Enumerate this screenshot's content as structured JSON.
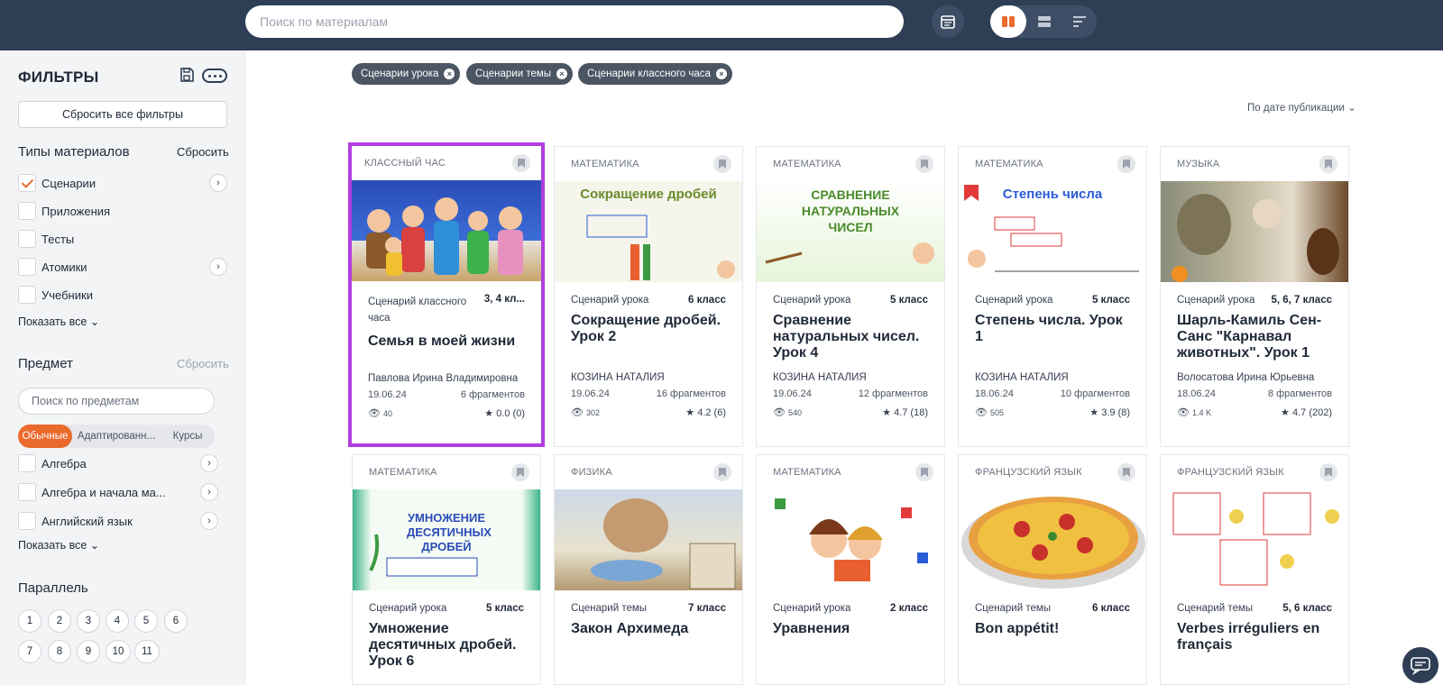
{
  "topbar": {
    "search_placeholder": "Поиск по материалам"
  },
  "sidebar": {
    "title": "ФИЛЬТРЫ",
    "reset_all": "Сбросить все фильтры",
    "types": {
      "title": "Типы материалов",
      "reset": "Сбросить",
      "items": [
        {
          "label": "Сценарии",
          "checked": true
        },
        {
          "label": "Приложения",
          "checked": false
        },
        {
          "label": "Тесты",
          "checked": false
        },
        {
          "label": "Атомики",
          "checked": false
        },
        {
          "label": "Учебники",
          "checked": false
        }
      ],
      "show_all": "Показать все"
    },
    "subject": {
      "title": "Предмет",
      "reset": "Сбросить",
      "search_placeholder": "Поиск по предметам",
      "segments": [
        "Обычные",
        "Адаптированн...",
        "Курсы"
      ],
      "items": [
        {
          "label": "Алгебра"
        },
        {
          "label": "Алгебра и начала ма..."
        },
        {
          "label": "Английский язык"
        }
      ],
      "show_all": "Показать все"
    },
    "parallel": {
      "title": "Параллель",
      "grades": [
        "1",
        "2",
        "3",
        "4",
        "5",
        "6",
        "7",
        "8",
        "9",
        "10",
        "11"
      ]
    }
  },
  "main": {
    "chips": [
      "Сценарии урока",
      "Сценарии темы",
      "Сценарии классного часа"
    ],
    "sort": "По дате публикации",
    "cards": [
      {
        "subject": "Классный час",
        "type": "Сценарий классного часа",
        "grade": "3, 4 кл...",
        "title": "Семья в моей жизни",
        "author": "Павлова Ирина Владимировна",
        "date": "19.06.24",
        "fragments": "6 фрагментов",
        "views": "40",
        "rating": "0.0 (0)",
        "image_caption": ""
      },
      {
        "subject": "Математика",
        "type": "Сценарий урока",
        "grade": "6 класс",
        "title": "Сокращение дробей. Урок 2",
        "author": "КОЗИНА НАТАЛИЯ",
        "date": "19.06.24",
        "fragments": "16 фрагментов",
        "views": "302",
        "rating": "4.2 (6)",
        "image_caption": "Сокращение дробей"
      },
      {
        "subject": "Математика",
        "type": "Сценарий урока",
        "grade": "5 класс",
        "title": "Сравнение натуральных чисел. Урок 4",
        "author": "КОЗИНА НАТАЛИЯ",
        "date": "19.06.24",
        "fragments": "12 фрагментов",
        "views": "540",
        "rating": "4.7 (18)",
        "image_caption": "СРАВНЕНИЕ НАТУРАЛЬНЫХ ЧИСЕЛ"
      },
      {
        "subject": "Математика",
        "type": "Сценарий урока",
        "grade": "5 класс",
        "title": "Степень числа. Урок 1",
        "author": "КОЗИНА НАТАЛИЯ",
        "date": "18.06.24",
        "fragments": "10 фрагментов",
        "views": "505",
        "rating": "3.9 (8)",
        "image_caption": "Степень числа"
      },
      {
        "subject": "Музыка",
        "type": "Сценарий урока",
        "grade": "5, 6, 7 класс",
        "title": "Шарль-Камиль Сен-Санс \"Карнавал животных\". Урок 1",
        "author": "Волосатова Ирина Юрьевна",
        "date": "18.06.24",
        "fragments": "8 фрагментов",
        "views": "1.4 K",
        "rating": "4.7 (202)",
        "image_caption": ""
      },
      {
        "subject": "Математика",
        "type": "Сценарий урока",
        "grade": "5 класс",
        "title": "Умножение десятичных дробей. Урок 6",
        "image_caption": "УМНОЖЕНИЕ ДЕСЯТИЧНЫХ ДРОБЕЙ"
      },
      {
        "subject": "Физика",
        "type": "Сценарий темы",
        "grade": "7 класс",
        "title": "Закон Архимеда",
        "image_caption": ""
      },
      {
        "subject": "Математика",
        "type": "Сценарий урока",
        "grade": "2 класс",
        "title": "Уравнения",
        "image_caption": ""
      },
      {
        "subject": "Французский язык",
        "type": "Сценарий темы",
        "grade": "6 класс",
        "title": "Bon appétit!",
        "image_caption": ""
      },
      {
        "subject": "Французский язык",
        "type": "Сценарий темы",
        "grade": "5, 6 класс",
        "title": "Verbes irréguliers en français",
        "image_caption": ""
      }
    ]
  }
}
